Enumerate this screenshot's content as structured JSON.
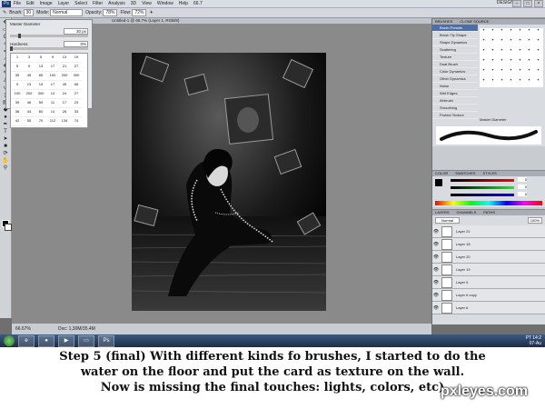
{
  "menubar": {
    "logo": "Ps",
    "items": [
      "File",
      "Edit",
      "Image",
      "Layer",
      "Select",
      "Filter",
      "Analysis",
      "3D",
      "View",
      "Window",
      "Help"
    ],
    "zoom": "66.7",
    "workspace": "DESIGN"
  },
  "options": {
    "brush_label": "Brush:",
    "brush_size": "30",
    "mode_label": "Mode:",
    "mode_value": "Normal",
    "opacity_label": "Opacity:",
    "opacity_value": "78%",
    "flow_label": "Flow:",
    "flow_value": "72%"
  },
  "brush_popup": {
    "diameter_label": "Master Diameter",
    "diameter_value": "30 px",
    "hardness_label": "Hardness:",
    "hardness_value": "0%",
    "hardness_level": 0.0,
    "presets": [
      "1",
      "3",
      "5",
      "9",
      "13",
      "19",
      "5",
      "9",
      "13",
      "17",
      "21",
      "27",
      "35",
      "45",
      "65",
      "100",
      "200",
      "300",
      "9",
      "13",
      "19",
      "17",
      "45",
      "65",
      "100",
      "200",
      "300",
      "14",
      "24",
      "27",
      "39",
      "46",
      "59",
      "11",
      "17",
      "23",
      "36",
      "44",
      "60",
      "14",
      "26",
      "33",
      "42",
      "55",
      "70",
      "112",
      "134",
      "74"
    ]
  },
  "document": {
    "title": "Untitled-1 @ 66.7% (Layer 1, RGB/8)",
    "zoom": "66.67%",
    "doc_size": "Doc: 1,30M/35.4M"
  },
  "brushes_panel": {
    "tabs": [
      "BRUSHES",
      "CLONE SOURCE"
    ],
    "items": [
      "Brush Presets",
      "Brush Tip Shape",
      "Shape Dynamics",
      "Scattering",
      "Texture",
      "Dual Brush",
      "Color Dynamics",
      "Other Dynamics",
      "Noise",
      "Wet Edges",
      "Airbrush",
      "Smoothing",
      "Protect Texture"
    ],
    "selected": 0,
    "master_diameter": "Master Diameter"
  },
  "color_panel": {
    "tabs": [
      "COLOR",
      "SWATCHES",
      "STYLES"
    ],
    "r": "0",
    "g": "0",
    "b": "0"
  },
  "layers_panel": {
    "tabs": [
      "LAYERS",
      "CHANNELS",
      "PATHS"
    ],
    "blend": "Normal",
    "opacity": "100%",
    "layers": [
      "Layer 21",
      "Layer 18",
      "Layer 20",
      "Layer 19",
      "Layer 5",
      "Layer 6 copy",
      "Layer 6"
    ]
  },
  "taskbar": {
    "lang": "PT",
    "time": "14:2",
    "date": "07-Au"
  },
  "caption": {
    "line1": "Step 5 (final) With different kinds fo brushes, I started to do the",
    "line2": "water on the floor and put the card as texture on the wall.",
    "line3": "Now is missing the final touches: lights, colors, etc)"
  },
  "watermark": "pxleyes.com"
}
